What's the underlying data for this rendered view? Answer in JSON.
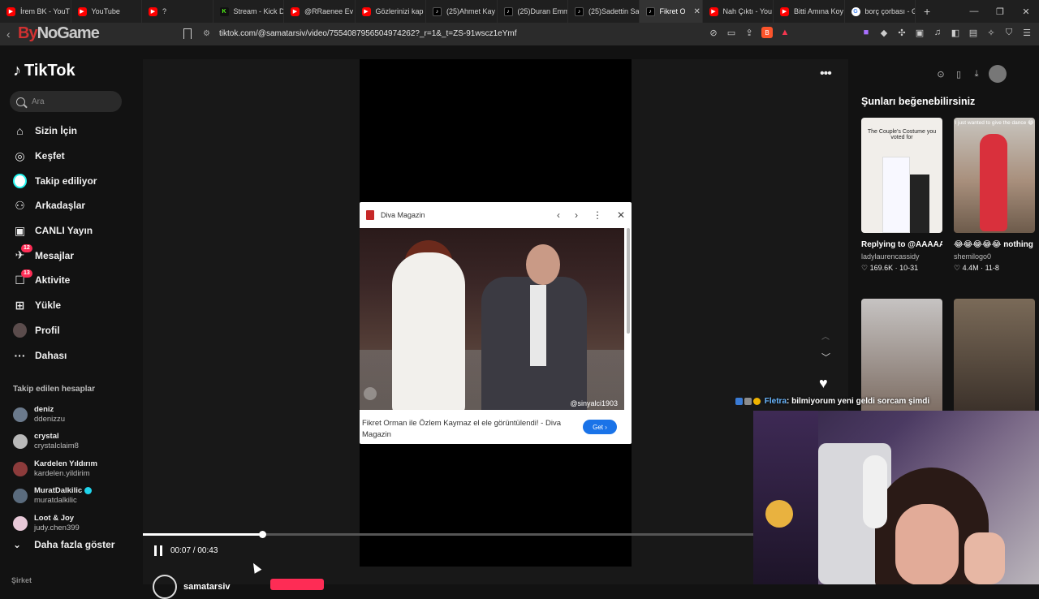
{
  "browser": {
    "tabs": [
      {
        "label": "İrem BK - YouT",
        "fav": "yt"
      },
      {
        "label": "YouTube",
        "fav": "yt"
      },
      {
        "label": "?",
        "fav": "yt"
      },
      {
        "label": "Stream - Kick D",
        "fav": "kick"
      },
      {
        "label": "@RRaenee Ev",
        "fav": "yt"
      },
      {
        "label": "Gözlerinizi kap",
        "fav": "yt"
      },
      {
        "label": "(25)Ahmet Kay",
        "fav": "tt"
      },
      {
        "label": "(25)Duran Emm",
        "fav": "tt"
      },
      {
        "label": "(25)Sadettin Sa",
        "fav": "tt"
      },
      {
        "label": "Fikret O",
        "fav": "tt",
        "active": true
      },
      {
        "label": "Nah Çıktı - You",
        "fav": "yt"
      },
      {
        "label": "Bitti Amına Koy",
        "fav": "yt"
      },
      {
        "label": "borç çorbası - G",
        "fav": "gg"
      }
    ],
    "url": "tiktok.com/@samatarsiv/video/7554087956504974262?_r=1&_t=ZS-91wscz1eYmf",
    "overlay_logo": {
      "prefix": "By",
      "rest": "NoGame"
    }
  },
  "sidebar": {
    "logo": "TikTok",
    "search_placeholder": "Ara",
    "nav": [
      {
        "label": "Sizin İçin",
        "icon": "home-icon",
        "glyph": "⌂"
      },
      {
        "label": "Keşfet",
        "icon": "compass-icon",
        "glyph": "◎"
      },
      {
        "label": "Takip ediliyor",
        "icon": "following-avatar-icon",
        "glyph": ""
      },
      {
        "label": "Arkadaşlar",
        "icon": "friends-icon",
        "glyph": "⚇"
      },
      {
        "label": "CANLI Yayın",
        "icon": "live-icon",
        "glyph": "▣"
      },
      {
        "label": "Mesajlar",
        "icon": "messages-icon",
        "glyph": "✈",
        "badge": "12"
      },
      {
        "label": "Aktivite",
        "icon": "activity-icon",
        "glyph": "☐",
        "badge": "13"
      },
      {
        "label": "Yükle",
        "icon": "upload-icon",
        "glyph": "⊞"
      },
      {
        "label": "Profil",
        "icon": "profile-avatar-icon",
        "glyph": ""
      },
      {
        "label": "Dahası",
        "icon": "more-icon",
        "glyph": "···"
      }
    ],
    "following_title": "Takip edilen hesaplar",
    "following": [
      {
        "name": "deniz",
        "handle": "ddenizzu",
        "color": "#6b7a8c"
      },
      {
        "name": "crystal",
        "handle": "crystalclaim8",
        "color": "#b9b9b9"
      },
      {
        "name": "Kardelen Yıldırım",
        "handle": "kardelen.yildirim",
        "color": "#8c3b3b"
      },
      {
        "name": "MuratDalkilic",
        "handle": "muratdalkilic",
        "color": "#5a6b7d",
        "verified": true
      },
      {
        "name": "Loot & Joy",
        "handle": "judy.chen399",
        "color": "#e8c9d8"
      }
    ],
    "show_more": "Daha fazla göster",
    "footer": "Şirket"
  },
  "video": {
    "popup_source": "Diva Magazin",
    "watermark": "@sinyalci1903",
    "caption": "Fikret Orman ile Özlem Kaymaz el ele görüntülendi! - Diva Magazin",
    "get_label": "Get ›",
    "time": "00:07 / 00:43",
    "progress_fraction": 0.196,
    "author": "samatarsiv"
  },
  "recommendations": {
    "title": "Şunları beğenebilirsiniz",
    "items": [
      {
        "thumb_caption": "The Couple's Costume you voted for",
        "title": "Replying to @AAAAAA ! ∞ ...",
        "user": "ladylaurencassidy",
        "likes": "♡ 169.6K · 10-31"
      },
      {
        "thumb_caption": "I just wanted to give the dance 😂",
        "title": "😂😂😂😂😂 nothing beats a jet...",
        "user": "shemilogo0",
        "likes": "♡ 4.4M · 11-8"
      },
      {
        "thumb_caption": "",
        "title": "",
        "user": "",
        "likes": ""
      },
      {
        "thumb_caption": "",
        "title": "",
        "user": "",
        "likes": ""
      }
    ]
  },
  "stream_overlay": {
    "chat_user": "Fletra",
    "chat_message": ": bilmiyorum yeni geldi sorcam şimdi"
  }
}
